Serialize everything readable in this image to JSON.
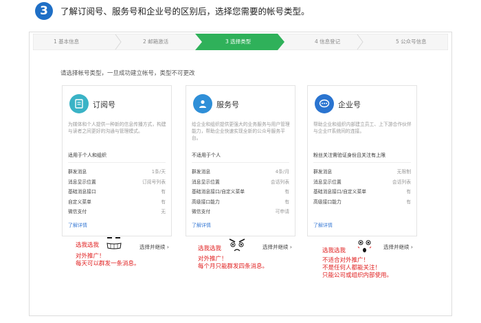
{
  "header": {
    "step_number": "3",
    "title": "了解订阅号、服务号和企业号的区别后，选择您需要的帐号类型。"
  },
  "progress": {
    "steps": [
      "1 基本信息",
      "2 邮箱激活",
      "3 选择类型",
      "4 信息登记",
      "5 公众号信息"
    ],
    "active_index": 2,
    "active_color": "#2fb15a"
  },
  "notice": "请选择帐号类型，一旦成功建立帐号，类型不可更改",
  "cards": [
    {
      "icon": "subscription-doc-icon",
      "icon_color": "#3ab3c6",
      "title": "订阅号",
      "desc": "为媒体和个人提供一种新的信息传播方式，构建与读者之间更好的沟通与管理模式。",
      "fit": "适用于个人和组织",
      "rows": [
        {
          "label": "群发消息",
          "value": "1条/天"
        },
        {
          "label": "消息显示位置",
          "value": "订阅号列表"
        },
        {
          "label": "基础消息接口",
          "value": "有"
        },
        {
          "label": "自定义菜单",
          "value": "有"
        },
        {
          "label": "微信支付",
          "value": "无"
        }
      ],
      "more": "了解详情",
      "select": "选择并继续",
      "annotation": [
        "选我选我",
        "对外推广！",
        "每天可以群发一条消息。"
      ]
    },
    {
      "icon": "service-user-icon",
      "icon_color": "#2f8fd8",
      "title": "服务号",
      "desc": "给企业和组织提供更强大的业务服务与用户管理能力，帮助企业快速实现全新的公众号服务平台。",
      "fit": "不适用于个人",
      "rows": [
        {
          "label": "群发消息",
          "value": "4条/月"
        },
        {
          "label": "消息显示位置",
          "value": "会话列表"
        },
        {
          "label": "基础消息接口/自定义菜单",
          "value": "有"
        },
        {
          "label": "高级接口能力",
          "value": "有"
        },
        {
          "label": "微信支付",
          "value": "可申请"
        }
      ],
      "more": "了解详情",
      "select": "选择并继续",
      "annotation": [
        "选我选我",
        "对外推广！",
        "每个月只能群发四条消息。"
      ]
    },
    {
      "icon": "enterprise-chat-icon",
      "icon_color": "#2a74d0",
      "title": "企业号",
      "desc": "帮助企业和组织内部建立员工、上下游合作伙伴与企业IT系统间的连接。",
      "fit": "粉丝关注需验证身份且关注有上限",
      "rows": [
        {
          "label": "群发消息",
          "value": "无限制"
        },
        {
          "label": "消息显示位置",
          "value": "会话列表"
        },
        {
          "label": "基础消息接口/自定义菜单",
          "value": "有"
        },
        {
          "label": "高级接口能力",
          "value": "有"
        }
      ],
      "more": "了解详情",
      "select": "选择并继续",
      "annotation": [
        "选我选我",
        "不适合对外推广！",
        "不是任何人都能关注！",
        "只能公司或组织内部使用。"
      ]
    }
  ]
}
